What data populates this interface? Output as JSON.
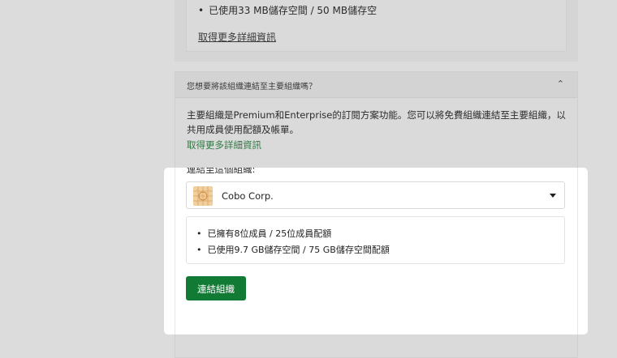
{
  "top_section": {
    "storage_usage": "已使用33 MB儲存空間 / 50 MB儲存空",
    "more_info_link": "取得更多詳細資訊"
  },
  "accordion": {
    "title": "您想要將該組織連結至主要組織嗎？",
    "chevron": "⌃",
    "description": "主要組織是Premium和Enterprise的訂閱方案功能。您可以將免費組織連結至主要組織，以共用成員使用配額及帳單。",
    "more_info_link": "取得更多詳細資訊"
  },
  "connect": {
    "label": "連結至這個組織:",
    "selected_org": "Cobo Corp.",
    "usage": [
      "已擁有8位成員 / 25位成員配額",
      "已使用9.7 GB儲存空間 / 75 GB儲存空間配額"
    ],
    "button_label": "連結組織"
  },
  "colors": {
    "primary_button": "#117a35",
    "link_green": "#2f7a43",
    "dim_background": "#dcdcdc"
  }
}
